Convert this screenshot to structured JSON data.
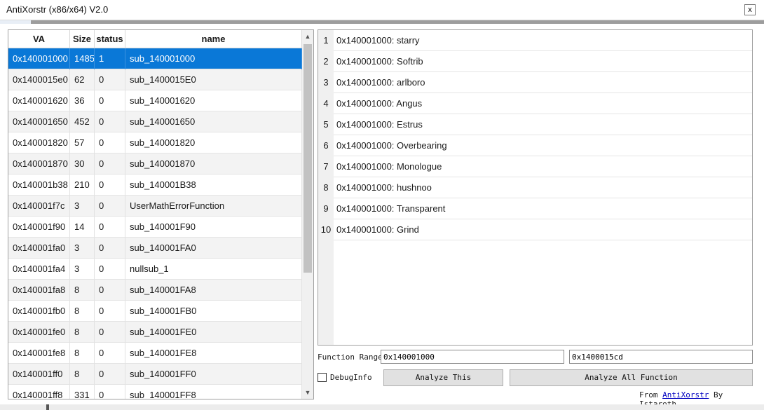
{
  "window": {
    "title": "AntiXorstr (x86/x64) V2.0",
    "close_label": "x"
  },
  "functions": {
    "headers": [
      "VA",
      "Size",
      "status",
      "name"
    ],
    "rows": [
      {
        "va": "0x140001000",
        "size": "1485",
        "status": "1",
        "name": "sub_140001000",
        "selected": true
      },
      {
        "va": "0x1400015e0",
        "size": "62",
        "status": "0",
        "name": "sub_1400015E0"
      },
      {
        "va": "0x140001620",
        "size": "36",
        "status": "0",
        "name": "sub_140001620"
      },
      {
        "va": "0x140001650",
        "size": "452",
        "status": "0",
        "name": "sub_140001650"
      },
      {
        "va": "0x140001820",
        "size": "57",
        "status": "0",
        "name": "sub_140001820"
      },
      {
        "va": "0x140001870",
        "size": "30",
        "status": "0",
        "name": "sub_140001870"
      },
      {
        "va": "0x140001b38",
        "size": "210",
        "status": "0",
        "name": "sub_140001B38"
      },
      {
        "va": "0x140001f7c",
        "size": "3",
        "status": "0",
        "name": "UserMathErrorFunction"
      },
      {
        "va": "0x140001f90",
        "size": "14",
        "status": "0",
        "name": "sub_140001F90"
      },
      {
        "va": "0x140001fa0",
        "size": "3",
        "status": "0",
        "name": "sub_140001FA0"
      },
      {
        "va": "0x140001fa4",
        "size": "3",
        "status": "0",
        "name": "nullsub_1"
      },
      {
        "va": "0x140001fa8",
        "size": "8",
        "status": "0",
        "name": "sub_140001FA8"
      },
      {
        "va": "0x140001fb0",
        "size": "8",
        "status": "0",
        "name": "sub_140001FB0"
      },
      {
        "va": "0x140001fe0",
        "size": "8",
        "status": "0",
        "name": "sub_140001FE0"
      },
      {
        "va": "0x140001fe8",
        "size": "8",
        "status": "0",
        "name": "sub_140001FE8"
      },
      {
        "va": "0x140001ff0",
        "size": "8",
        "status": "0",
        "name": "sub_140001FF0"
      },
      {
        "va": "0x140001ff8",
        "size": "331",
        "status": "0",
        "name": "sub_140001FF8"
      }
    ]
  },
  "results": [
    {
      "num": "1",
      "text": "0x140001000: starry"
    },
    {
      "num": "2",
      "text": "0x140001000: Softrib"
    },
    {
      "num": "3",
      "text": "0x140001000: arlboro"
    },
    {
      "num": "4",
      "text": "0x140001000: Angus"
    },
    {
      "num": "5",
      "text": "0x140001000: Estrus"
    },
    {
      "num": "6",
      "text": "0x140001000: Overbearing"
    },
    {
      "num": "7",
      "text": "0x140001000: Monologue"
    },
    {
      "num": "8",
      "text": "0x140001000: hushnoo"
    },
    {
      "num": "9",
      "text": "0x140001000: Transparent"
    },
    {
      "num": "10",
      "text": "0x140001000: Grind"
    }
  ],
  "controls": {
    "range_label": "Function Range",
    "range_start": "0x140001000",
    "range_end": "0x1400015cd",
    "debug_label": "DebugInfo",
    "debug_checked": false,
    "analyze_this": "Analyze This",
    "analyze_all": "Analyze All Function"
  },
  "footer": {
    "prefix": "From",
    "link": "AntiXorstr",
    "suffix": "By Istaroth"
  },
  "icons": {
    "close": "close-icon",
    "scroll_up": "scroll-up-arrow-icon",
    "scroll_down": "scroll-down-arrow-icon"
  },
  "colors": {
    "selection": "#0a78d7",
    "alt_row": "#f3f3f3",
    "link": "#0000c0"
  }
}
